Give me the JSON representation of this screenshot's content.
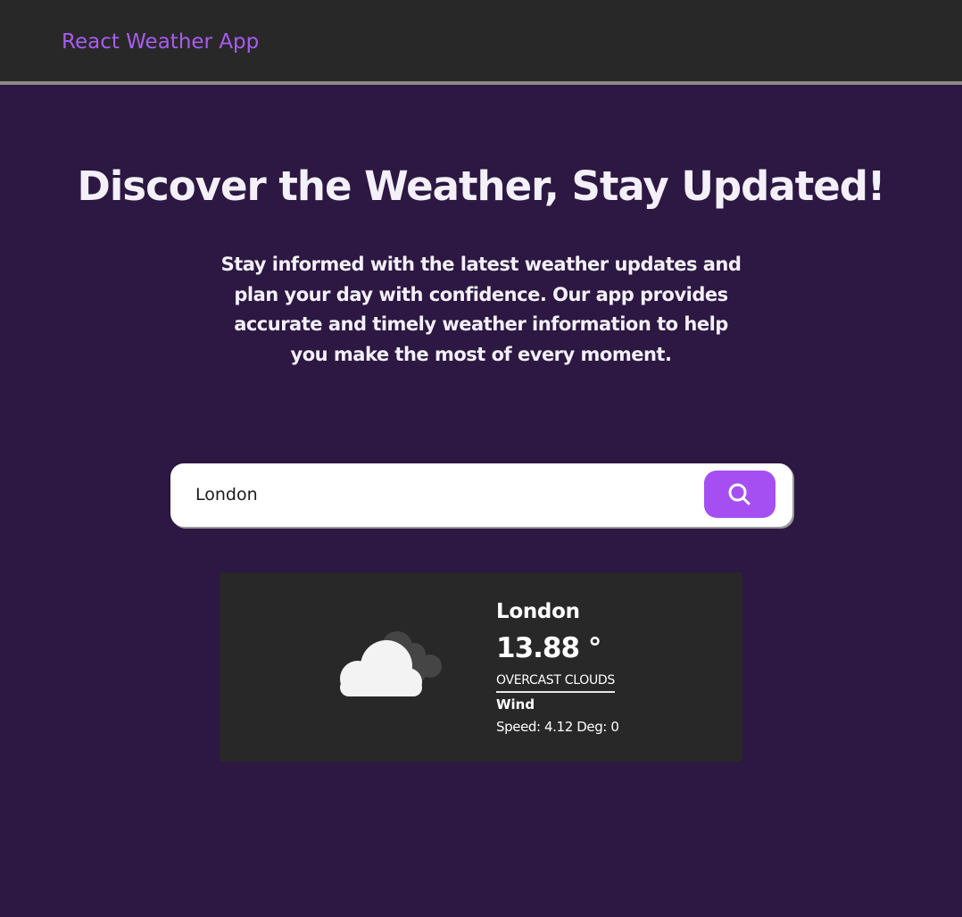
{
  "navbar": {
    "brand": "React Weather App"
  },
  "hero": {
    "title": "Discover the Weather, Stay Updated!",
    "subtitle": "Stay informed with the latest weather updates and plan your day with confidence. Our app provides accurate and timely weather information to help you make the most of every moment."
  },
  "search": {
    "value": "London",
    "icon": "search-icon"
  },
  "weather": {
    "icon": "overcast-clouds-icon",
    "city": "London",
    "temperature": "13.88 °",
    "condition": "OVERCAST CLOUDS",
    "wind_label": "Wind",
    "wind_details": "Speed: 4.12 Deg: 0"
  },
  "colors": {
    "background": "#2c1842",
    "navbar": "#282828",
    "accent": "#a54ff3",
    "card": "#282828"
  }
}
